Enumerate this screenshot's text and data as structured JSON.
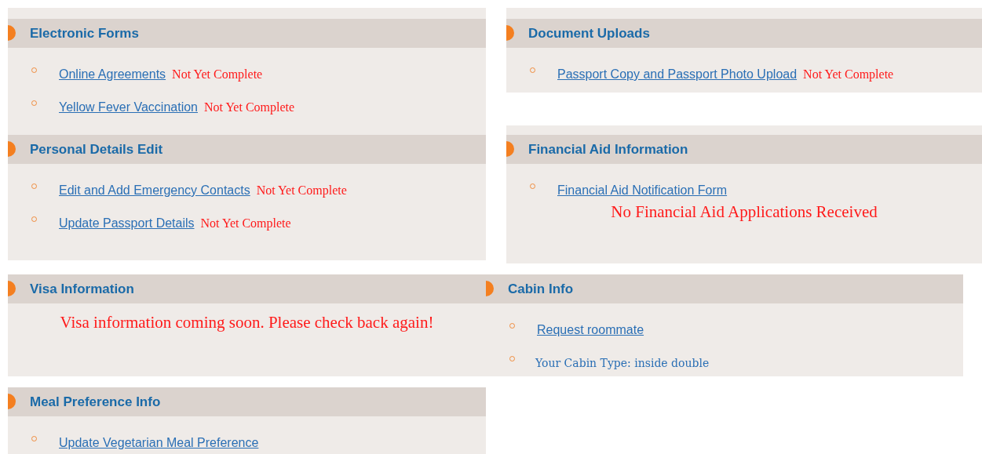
{
  "top_left": [
    {
      "title": "Electronic Forms",
      "items": [
        {
          "kind": "link",
          "label": "Online Agreements",
          "status": "Not Yet Complete"
        },
        {
          "kind": "link",
          "label": "Yellow Fever Vaccination",
          "status": "Not Yet Complete"
        }
      ]
    },
    {
      "title": "Personal Details Edit",
      "items": [
        {
          "kind": "link",
          "label": "Edit and Add Emergency Contacts",
          "status": "Not Yet Complete"
        },
        {
          "kind": "link",
          "label": "Update Passport Details",
          "status": "Not Yet Complete"
        }
      ]
    }
  ],
  "top_right": [
    {
      "title": "Document Uploads",
      "items": [
        {
          "kind": "link",
          "label": "Passport Copy and Passport Photo Upload",
          "status": "Not Yet Complete"
        }
      ]
    },
    {
      "title": "Financial Aid Information",
      "items": [
        {
          "kind": "link",
          "label": "Financial Aid Notification Form"
        }
      ],
      "message": "No Financial Aid Applications Received"
    }
  ],
  "middle": [
    {
      "title": "Visa Information",
      "message": "Visa information coming soon. Please check back again!"
    },
    {
      "title": "Cabin Info",
      "items": [
        {
          "kind": "link",
          "label": "Request roommate"
        },
        {
          "kind": "text",
          "label": "Your Cabin Type: inside double"
        }
      ]
    }
  ],
  "bottom": [
    {
      "title": "Meal Preference Info",
      "items": [
        {
          "kind": "link",
          "label": "Update Vegetarian Meal Preference"
        }
      ]
    }
  ]
}
